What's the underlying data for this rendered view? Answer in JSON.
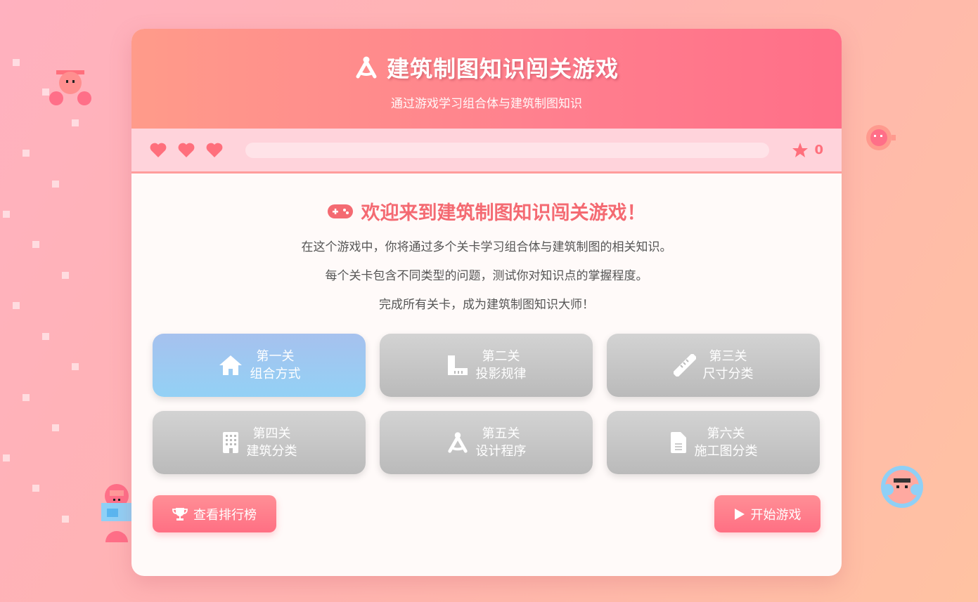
{
  "header": {
    "title": "建筑制图知识闯关游戏",
    "subtitle": "通过游戏学习组合体与建筑制图知识"
  },
  "status": {
    "lives": 3,
    "progress": 0,
    "score": "0"
  },
  "welcome": {
    "title": "欢迎来到建筑制图知识闯关游戏！",
    "paragraphs": [
      "在这个游戏中，你将通过多个关卡学习组合体与建筑制图的相关知识。",
      "每个关卡包含不同类型的问题，测试你对知识点的掌握程度。",
      "完成所有关卡，成为建筑制图知识大师！"
    ]
  },
  "levels": [
    {
      "number": "第一关",
      "name": "组合方式",
      "icon": "home-icon",
      "unlocked": true
    },
    {
      "number": "第二关",
      "name": "投影规律",
      "icon": "ruler-combined-icon",
      "unlocked": false
    },
    {
      "number": "第三关",
      "name": "尺寸分类",
      "icon": "ruler-icon",
      "unlocked": false
    },
    {
      "number": "第四关",
      "name": "建筑分类",
      "icon": "building-icon",
      "unlocked": false
    },
    {
      "number": "第五关",
      "name": "设计程序",
      "icon": "compass-drafting-icon",
      "unlocked": false
    },
    {
      "number": "第六关",
      "name": "施工图分类",
      "icon": "file-icon",
      "unlocked": false
    }
  ],
  "buttons": {
    "leaderboard": "查看排行榜",
    "start": "开始游戏"
  },
  "colors": {
    "accent": "#ff7f8e",
    "active_level": "#a6c1ee",
    "locked_level": "#c4c4c4",
    "heart": "#ff6f7c"
  }
}
